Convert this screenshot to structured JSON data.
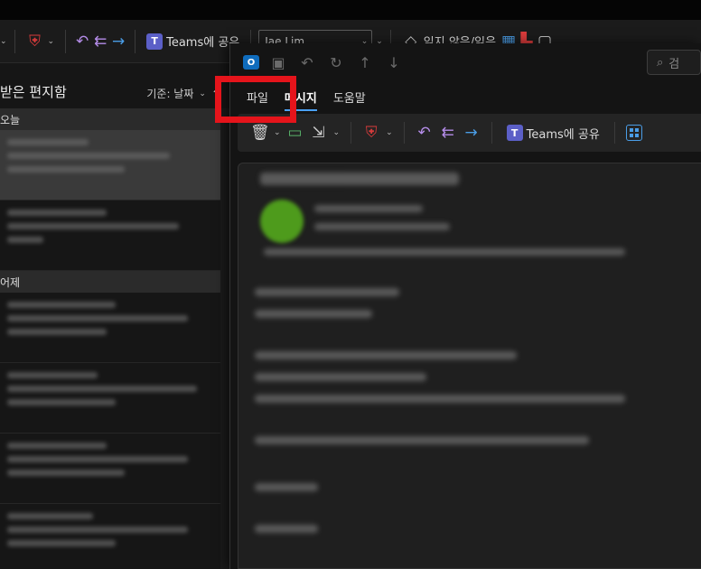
{
  "app": {
    "folder_title": "받은 편지함",
    "sort_label": "기준: 날짜",
    "sort_dir_icon": "arrow-up-icon"
  },
  "main_toolbar": {
    "teams_label": "Teams에 공유",
    "assign_value": "Jae Lim",
    "read_unread_label": "읽지 않음/읽음"
  },
  "mail_list": {
    "groups": [
      {
        "label": "오늘"
      },
      {
        "label": "어제"
      }
    ]
  },
  "message_window": {
    "menu": {
      "file": "파일",
      "message": "메시지",
      "help": "도움말"
    },
    "search_placeholder": "검",
    "ribbon": {
      "teams_label": "Teams에 공유"
    }
  },
  "colors": {
    "highlight": "#e5141b",
    "accent": "#4aa1f3",
    "teams": "#5b5fc7",
    "danger": "#d83b3b"
  }
}
